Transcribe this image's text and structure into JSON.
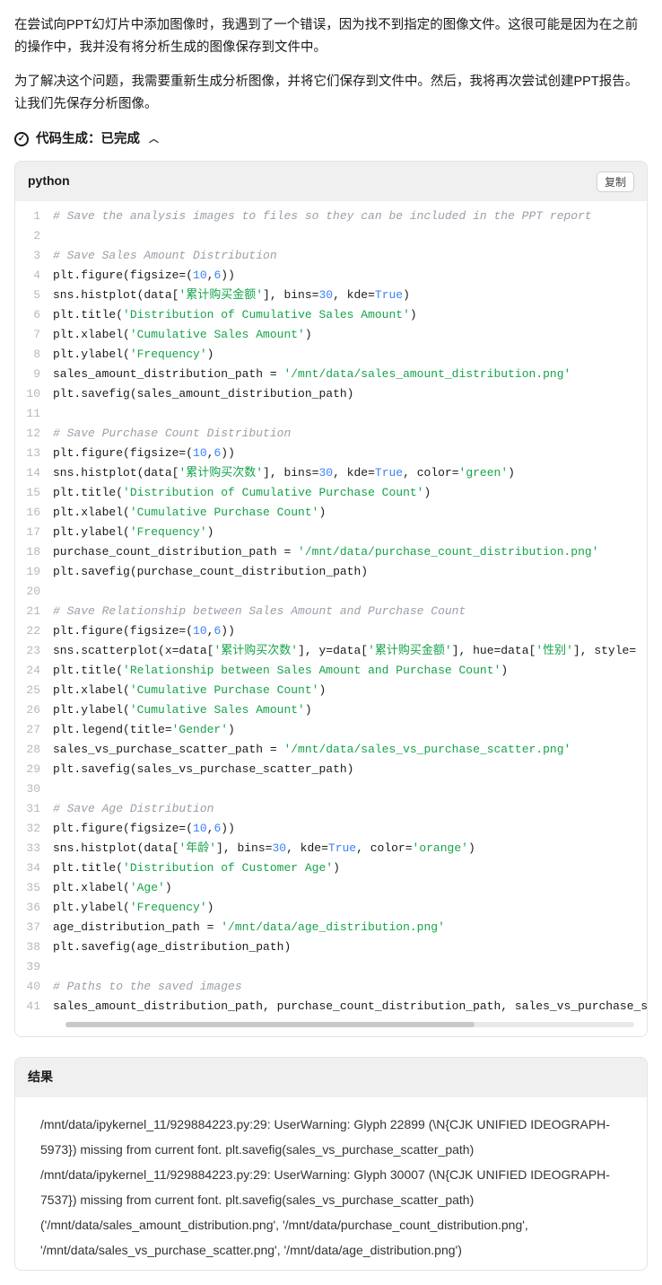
{
  "prose": {
    "p1": "在尝试向PPT幻灯片中添加图像时，我遇到了一个错误，因为找不到指定的图像文件。这很可能是因为在之前的操作中，我并没有将分析生成的图像保存到文件中。",
    "p2": "为了解决这个问题，我需要重新生成分析图像，并将它们保存到文件中。然后，我将再次尝试创建PPT报告。让我们先保存分析图像。"
  },
  "codegen": {
    "label": "代码生成：已完成"
  },
  "code": {
    "language": "python",
    "copy_label": "复制",
    "lines": [
      {
        "type": "comment",
        "text": "# Save the analysis images to files so they can be included in the PPT report"
      },
      {
        "type": "blank",
        "text": ""
      },
      {
        "type": "comment",
        "text": "# Save Sales Amount Distribution"
      },
      {
        "type": "code",
        "tokens": [
          [
            "func",
            "plt.figure"
          ],
          [
            "punct",
            "(figsize=("
          ],
          [
            "num",
            "10"
          ],
          [
            "punct",
            ","
          ],
          [
            "num",
            "6"
          ],
          [
            "punct",
            "))"
          ]
        ]
      },
      {
        "type": "code",
        "tokens": [
          [
            "func",
            "sns.histplot"
          ],
          [
            "punct",
            "(data["
          ],
          [
            "str",
            "'累计购买金额'"
          ],
          [
            "punct",
            "], bins="
          ],
          [
            "num",
            "30"
          ],
          [
            "punct",
            ", kde="
          ],
          [
            "bool",
            "True"
          ],
          [
            "punct",
            ")"
          ]
        ]
      },
      {
        "type": "code",
        "tokens": [
          [
            "func",
            "plt.title"
          ],
          [
            "punct",
            "("
          ],
          [
            "str",
            "'Distribution of Cumulative Sales Amount'"
          ],
          [
            "punct",
            ")"
          ]
        ]
      },
      {
        "type": "code",
        "tokens": [
          [
            "func",
            "plt.xlabel"
          ],
          [
            "punct",
            "("
          ],
          [
            "str",
            "'Cumulative Sales Amount'"
          ],
          [
            "punct",
            ")"
          ]
        ]
      },
      {
        "type": "code",
        "tokens": [
          [
            "func",
            "plt.ylabel"
          ],
          [
            "punct",
            "("
          ],
          [
            "str",
            "'Frequency'"
          ],
          [
            "punct",
            ")"
          ]
        ]
      },
      {
        "type": "code",
        "tokens": [
          [
            "func",
            "sales_amount_distribution_path = "
          ],
          [
            "str",
            "'/mnt/data/sales_amount_distribution.png'"
          ]
        ]
      },
      {
        "type": "code",
        "tokens": [
          [
            "func",
            "plt.savefig"
          ],
          [
            "punct",
            "(sales_amount_distribution_path)"
          ]
        ]
      },
      {
        "type": "blank",
        "text": ""
      },
      {
        "type": "comment",
        "text": "# Save Purchase Count Distribution"
      },
      {
        "type": "code",
        "tokens": [
          [
            "func",
            "plt.figure"
          ],
          [
            "punct",
            "(figsize=("
          ],
          [
            "num",
            "10"
          ],
          [
            "punct",
            ","
          ],
          [
            "num",
            "6"
          ],
          [
            "punct",
            "))"
          ]
        ]
      },
      {
        "type": "code",
        "tokens": [
          [
            "func",
            "sns.histplot"
          ],
          [
            "punct",
            "(data["
          ],
          [
            "str",
            "'累计购买次数'"
          ],
          [
            "punct",
            "], bins="
          ],
          [
            "num",
            "30"
          ],
          [
            "punct",
            ", kde="
          ],
          [
            "bool",
            "True"
          ],
          [
            "punct",
            ", color="
          ],
          [
            "str",
            "'green'"
          ],
          [
            "punct",
            ")"
          ]
        ]
      },
      {
        "type": "code",
        "tokens": [
          [
            "func",
            "plt.title"
          ],
          [
            "punct",
            "("
          ],
          [
            "str",
            "'Distribution of Cumulative Purchase Count'"
          ],
          [
            "punct",
            ")"
          ]
        ]
      },
      {
        "type": "code",
        "tokens": [
          [
            "func",
            "plt.xlabel"
          ],
          [
            "punct",
            "("
          ],
          [
            "str",
            "'Cumulative Purchase Count'"
          ],
          [
            "punct",
            ")"
          ]
        ]
      },
      {
        "type": "code",
        "tokens": [
          [
            "func",
            "plt.ylabel"
          ],
          [
            "punct",
            "("
          ],
          [
            "str",
            "'Frequency'"
          ],
          [
            "punct",
            ")"
          ]
        ]
      },
      {
        "type": "code",
        "tokens": [
          [
            "func",
            "purchase_count_distribution_path = "
          ],
          [
            "str",
            "'/mnt/data/purchase_count_distribution.png'"
          ]
        ]
      },
      {
        "type": "code",
        "tokens": [
          [
            "func",
            "plt.savefig"
          ],
          [
            "punct",
            "(purchase_count_distribution_path)"
          ]
        ]
      },
      {
        "type": "blank",
        "text": ""
      },
      {
        "type": "comment",
        "text": "# Save Relationship between Sales Amount and Purchase Count"
      },
      {
        "type": "code",
        "tokens": [
          [
            "func",
            "plt.figure"
          ],
          [
            "punct",
            "(figsize=("
          ],
          [
            "num",
            "10"
          ],
          [
            "punct",
            ","
          ],
          [
            "num",
            "6"
          ],
          [
            "punct",
            "))"
          ]
        ]
      },
      {
        "type": "code",
        "tokens": [
          [
            "func",
            "sns.scatterplot"
          ],
          [
            "punct",
            "(x=data["
          ],
          [
            "str",
            "'累计购买次数'"
          ],
          [
            "punct",
            "], y=data["
          ],
          [
            "str",
            "'累计购买金额'"
          ],
          [
            "punct",
            "], hue=data["
          ],
          [
            "str",
            "'性别'"
          ],
          [
            "punct",
            "], style="
          ]
        ]
      },
      {
        "type": "code",
        "tokens": [
          [
            "func",
            "plt.title"
          ],
          [
            "punct",
            "("
          ],
          [
            "str",
            "'Relationship between Sales Amount and Purchase Count'"
          ],
          [
            "punct",
            ")"
          ]
        ]
      },
      {
        "type": "code",
        "tokens": [
          [
            "func",
            "plt.xlabel"
          ],
          [
            "punct",
            "("
          ],
          [
            "str",
            "'Cumulative Purchase Count'"
          ],
          [
            "punct",
            ")"
          ]
        ]
      },
      {
        "type": "code",
        "tokens": [
          [
            "func",
            "plt.ylabel"
          ],
          [
            "punct",
            "("
          ],
          [
            "str",
            "'Cumulative Sales Amount'"
          ],
          [
            "punct",
            ")"
          ]
        ]
      },
      {
        "type": "code",
        "tokens": [
          [
            "func",
            "plt.legend"
          ],
          [
            "punct",
            "(title="
          ],
          [
            "str",
            "'Gender'"
          ],
          [
            "punct",
            ")"
          ]
        ]
      },
      {
        "type": "code",
        "tokens": [
          [
            "func",
            "sales_vs_purchase_scatter_path = "
          ],
          [
            "str",
            "'/mnt/data/sales_vs_purchase_scatter.png'"
          ]
        ]
      },
      {
        "type": "code",
        "tokens": [
          [
            "func",
            "plt.savefig"
          ],
          [
            "punct",
            "(sales_vs_purchase_scatter_path)"
          ]
        ]
      },
      {
        "type": "blank",
        "text": ""
      },
      {
        "type": "comment",
        "text": "# Save Age Distribution"
      },
      {
        "type": "code",
        "tokens": [
          [
            "func",
            "plt.figure"
          ],
          [
            "punct",
            "(figsize=("
          ],
          [
            "num",
            "10"
          ],
          [
            "punct",
            ","
          ],
          [
            "num",
            "6"
          ],
          [
            "punct",
            "))"
          ]
        ]
      },
      {
        "type": "code",
        "tokens": [
          [
            "func",
            "sns.histplot"
          ],
          [
            "punct",
            "(data["
          ],
          [
            "str",
            "'年龄'"
          ],
          [
            "punct",
            "], bins="
          ],
          [
            "num",
            "30"
          ],
          [
            "punct",
            ", kde="
          ],
          [
            "bool",
            "True"
          ],
          [
            "punct",
            ", color="
          ],
          [
            "str",
            "'orange'"
          ],
          [
            "punct",
            ")"
          ]
        ]
      },
      {
        "type": "code",
        "tokens": [
          [
            "func",
            "plt.title"
          ],
          [
            "punct",
            "("
          ],
          [
            "str",
            "'Distribution of Customer Age'"
          ],
          [
            "punct",
            ")"
          ]
        ]
      },
      {
        "type": "code",
        "tokens": [
          [
            "func",
            "plt.xlabel"
          ],
          [
            "punct",
            "("
          ],
          [
            "str",
            "'Age'"
          ],
          [
            "punct",
            ")"
          ]
        ]
      },
      {
        "type": "code",
        "tokens": [
          [
            "func",
            "plt.ylabel"
          ],
          [
            "punct",
            "("
          ],
          [
            "str",
            "'Frequency'"
          ],
          [
            "punct",
            ")"
          ]
        ]
      },
      {
        "type": "code",
        "tokens": [
          [
            "func",
            "age_distribution_path = "
          ],
          [
            "str",
            "'/mnt/data/age_distribution.png'"
          ]
        ]
      },
      {
        "type": "code",
        "tokens": [
          [
            "func",
            "plt.savefig"
          ],
          [
            "punct",
            "(age_distribution_path)"
          ]
        ]
      },
      {
        "type": "blank",
        "text": ""
      },
      {
        "type": "comment",
        "text": "# Paths to the saved images"
      },
      {
        "type": "code",
        "tokens": [
          [
            "func",
            "sales_amount_distribution_path, purchase_count_distribution_path, sales_vs_purchase_s"
          ]
        ]
      }
    ]
  },
  "result": {
    "header": "结果",
    "lines": [
      "/mnt/data/ipykernel_11/929884223.py:29: UserWarning: Glyph 22899 (\\N{CJK UNIFIED IDEOGRAPH-5973}) missing from current font. plt.savefig(sales_vs_purchase_scatter_path)",
      "/mnt/data/ipykernel_11/929884223.py:29: UserWarning: Glyph 30007 (\\N{CJK UNIFIED IDEOGRAPH-7537}) missing from current font. plt.savefig(sales_vs_purchase_scatter_path)",
      "('/mnt/data/sales_amount_distribution.png', '/mnt/data/purchase_count_distribution.png', '/mnt/data/sales_vs_purchase_scatter.png', '/mnt/data/age_distribution.png')"
    ]
  }
}
